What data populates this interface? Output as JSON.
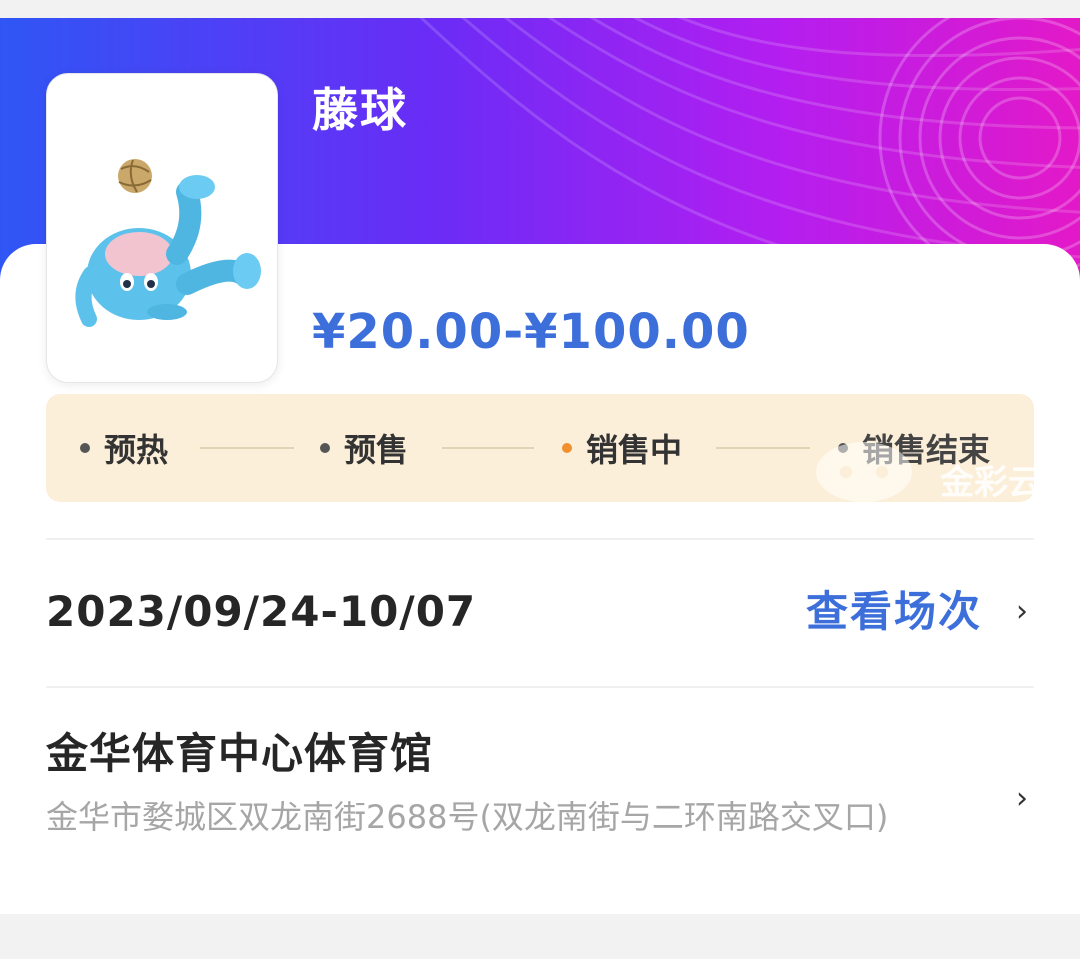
{
  "event": {
    "title": "藤球",
    "price_range": "¥20.00-¥100.00",
    "poster_alt": "藤球吉祥物"
  },
  "progress": {
    "steps": [
      {
        "label": "预热",
        "active": false
      },
      {
        "label": "预售",
        "active": false
      },
      {
        "label": "销售中",
        "active": true
      },
      {
        "label": "销售结束",
        "active": false
      }
    ]
  },
  "watermark": {
    "text": "金彩云"
  },
  "schedule": {
    "date_range": "2023/09/24-10/07",
    "view_sessions_label": "查看场次",
    "chevron": "›"
  },
  "venue": {
    "name": "金华体育中心体育馆",
    "address": "金华市婺城区双龙南街2688号(双龙南街与二环南路交叉口)",
    "chevron": "›"
  },
  "colors": {
    "accent_blue": "#3d6fdb",
    "active_dot": "#f0902f",
    "progress_bg": "#fcefd9",
    "hero_gradient": [
      "#2f56f5",
      "#6a2cf6",
      "#b31ef0",
      "#e319c8"
    ]
  }
}
